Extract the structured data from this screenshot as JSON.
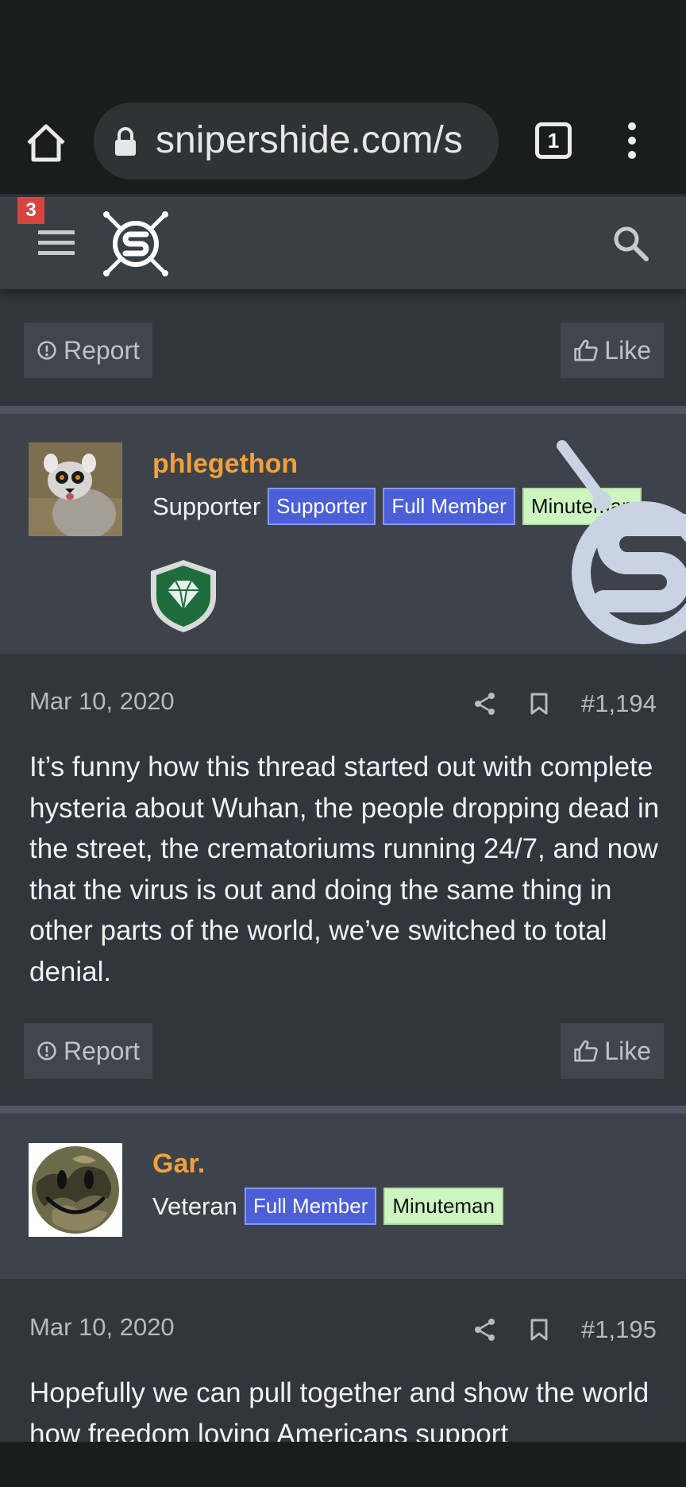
{
  "browser": {
    "url": "snipershide.com/s",
    "tab_count": "1"
  },
  "site_header": {
    "notification_count": "3"
  },
  "actions": {
    "report_label": "Report",
    "like_label": "Like"
  },
  "posts": [
    {
      "author": "phlegethon",
      "user_title": "Supporter",
      "badges": [
        "Supporter",
        "Full Member",
        "Minuteman"
      ],
      "date": "Mar 10, 2020",
      "post_number": "#1,194",
      "body": "It’s funny how this thread started out with complete hysteria about Wuhan, the people dropping dead in the street, the crematoriums running 24/7, and now that the virus is out and doing the same thing in other parts of the world, we’ve switched to total denial."
    },
    {
      "author": "Gar.",
      "user_title": "Veteran",
      "badges": [
        "Full Member",
        "Minuteman"
      ],
      "date": "Mar 10, 2020",
      "post_number": "#1,195",
      "body": "Hopefully we can pull together and show the world how freedom loving Americans support"
    }
  ],
  "colors": {
    "username": "#f0a03c",
    "badge_blue": "#4b5fd8",
    "badge_green": "#ccf5c0",
    "background": "#32353b",
    "user_band": "#3e434b"
  }
}
